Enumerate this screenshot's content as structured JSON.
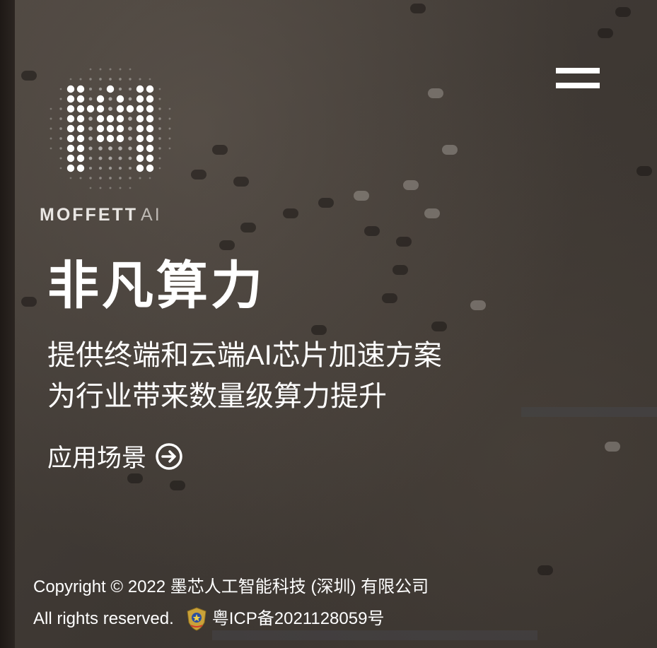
{
  "brand": {
    "logo_word": "MOFFETT",
    "logo_suffix": "AI"
  },
  "header": {
    "menu_icon": "hamburger-menu-icon"
  },
  "hero": {
    "title": "非凡算力",
    "subtitle_line1": "提供终端和云端AI芯片加速方案",
    "subtitle_line2": "为行业带来数量级算力提升",
    "cta_label": "应用场景",
    "cta_icon": "arrow-right-circle-icon"
  },
  "footer": {
    "copyright": "Copyright © 2022 墨芯人工智能科技 (深圳) 有限公司",
    "rights": "All rights reserved.",
    "police_icon": "police-badge-icon",
    "icp": "粤ICP备2021128059号"
  },
  "colors": {
    "text": "#ffffff",
    "background": "#3f3934"
  }
}
